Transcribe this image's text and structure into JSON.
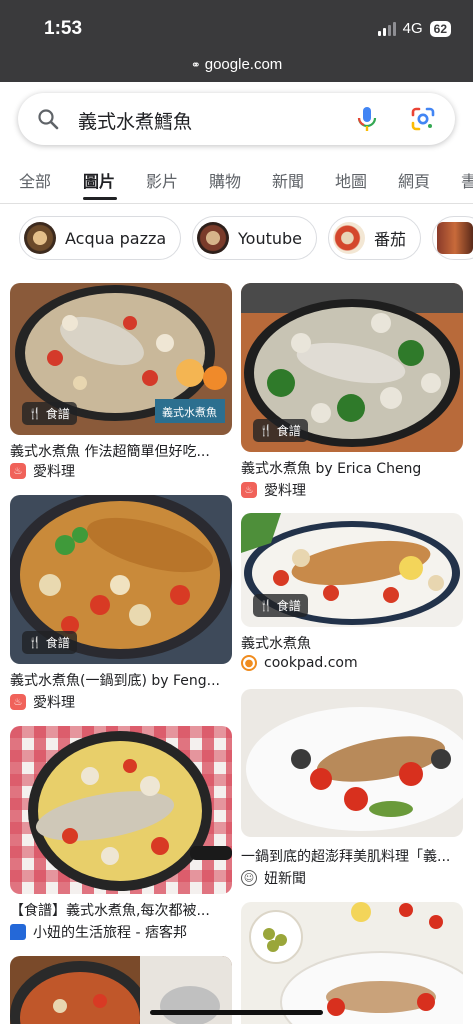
{
  "status_bar": {
    "time": "1:53",
    "network": "4G",
    "battery": "62"
  },
  "browser": {
    "url": "google.com"
  },
  "search": {
    "query": "義式水煮鱈魚"
  },
  "tabs": [
    {
      "label": "全部"
    },
    {
      "label": "圖片"
    },
    {
      "label": "影片"
    },
    {
      "label": "購物"
    },
    {
      "label": "新聞"
    },
    {
      "label": "地圖"
    },
    {
      "label": "網頁"
    },
    {
      "label": "書"
    }
  ],
  "chips": [
    {
      "label": "Acqua pazza"
    },
    {
      "label": "Youtube"
    },
    {
      "label": "番茄"
    }
  ],
  "results": [
    {
      "title": "義式水煮魚 作法超簡單但好吃...",
      "source": "愛料理",
      "badge": "食譜",
      "overlay_text": "義式水煮魚"
    },
    {
      "title": "義式水煮魚 by Erica Cheng",
      "source": "愛料理",
      "badge": "食譜"
    },
    {
      "title": "義式水煮魚(一鍋到底) by Feng...",
      "source": "愛料理",
      "badge": "食譜"
    },
    {
      "title": "義式水煮魚",
      "source": "cookpad.com",
      "badge": "食譜"
    },
    {
      "title": "【食譜】義式水煮魚,每次都被...",
      "source": "小妞的生活旅程 - 痞客邦"
    },
    {
      "title": "一鍋到底的超澎拜美肌料理「義...",
      "source": "妞新聞"
    }
  ],
  "colors": {
    "status_bg": "#3a3a3c",
    "accent_blue": "#4285f4",
    "aili_red": "#f0625a",
    "cookpad_orange": "#f08c1f"
  }
}
